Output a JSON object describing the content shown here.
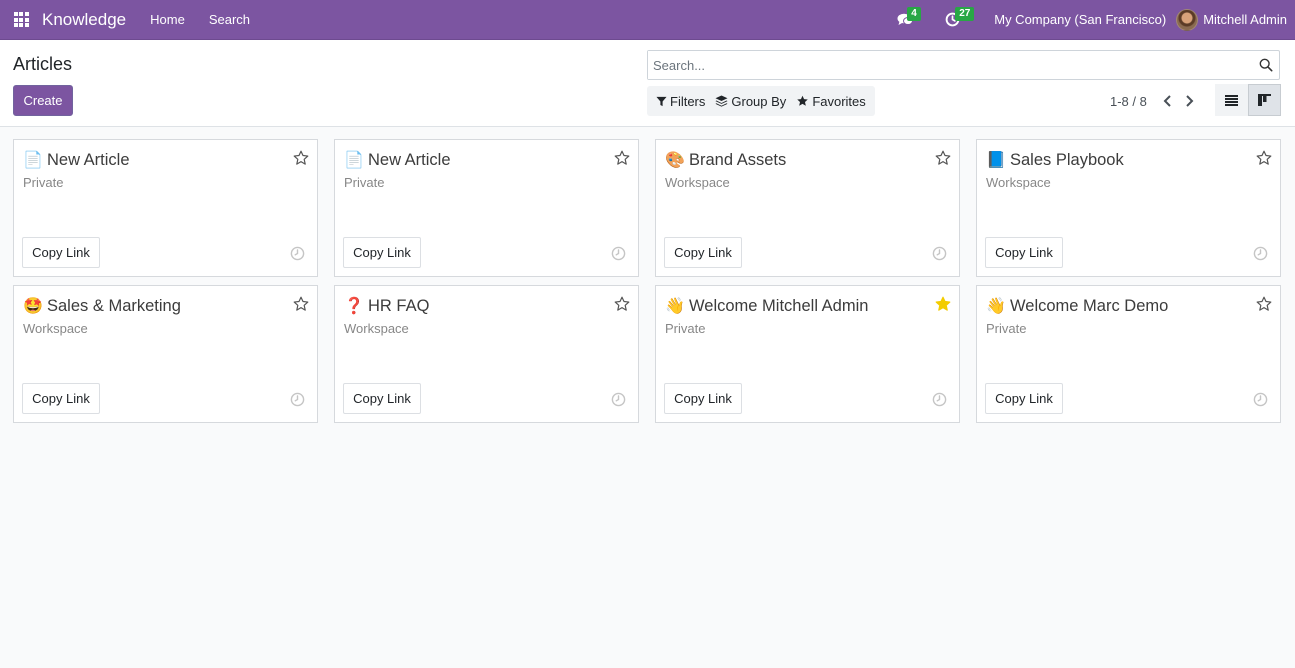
{
  "navbar": {
    "app_name": "Knowledge",
    "menu": [
      {
        "label": "Home"
      },
      {
        "label": "Search"
      }
    ],
    "messages_count": "4",
    "activities_count": "27",
    "company": "My Company (San Francisco)",
    "user": "Mitchell Admin"
  },
  "control_panel": {
    "title": "Articles",
    "create_label": "Create",
    "search_placeholder": "Search...",
    "filters_label": "Filters",
    "group_by_label": "Group By",
    "favorites_label": "Favorites",
    "pager": "1-8 / 8"
  },
  "colors": {
    "brand": "#7c55a1",
    "badge": "#28a745",
    "favorite_star": "#f3cc00"
  },
  "articles": [
    {
      "icon": "📄",
      "icon_name": "page-icon",
      "title": "New Article",
      "category": "Private",
      "favorite": false,
      "action": "Copy Link"
    },
    {
      "icon": "📄",
      "icon_name": "page-icon",
      "title": "New Article",
      "category": "Private",
      "favorite": false,
      "action": "Copy Link"
    },
    {
      "icon": "🎨",
      "icon_name": "palette-icon",
      "title": "Brand Assets",
      "category": "Workspace",
      "favorite": false,
      "action": "Copy Link"
    },
    {
      "icon": "📘",
      "icon_name": "blue-book-icon",
      "title": "Sales Playbook",
      "category": "Workspace",
      "favorite": false,
      "action": "Copy Link"
    },
    {
      "icon": "🤩",
      "icon_name": "star-struck-icon",
      "title": "Sales & Marketing",
      "category": "Workspace",
      "favorite": false,
      "action": "Copy Link"
    },
    {
      "icon": "❓",
      "icon_name": "question-mark-icon",
      "title": "HR FAQ",
      "category": "Workspace",
      "favorite": false,
      "action": "Copy Link"
    },
    {
      "icon": "👋",
      "icon_name": "waving-hand-icon",
      "title": "Welcome Mitchell Admin",
      "category": "Private",
      "favorite": true,
      "action": "Copy Link"
    },
    {
      "icon": "👋",
      "icon_name": "waving-hand-icon",
      "title": "Welcome Marc Demo",
      "category": "Private",
      "favorite": false,
      "action": "Copy Link"
    }
  ]
}
